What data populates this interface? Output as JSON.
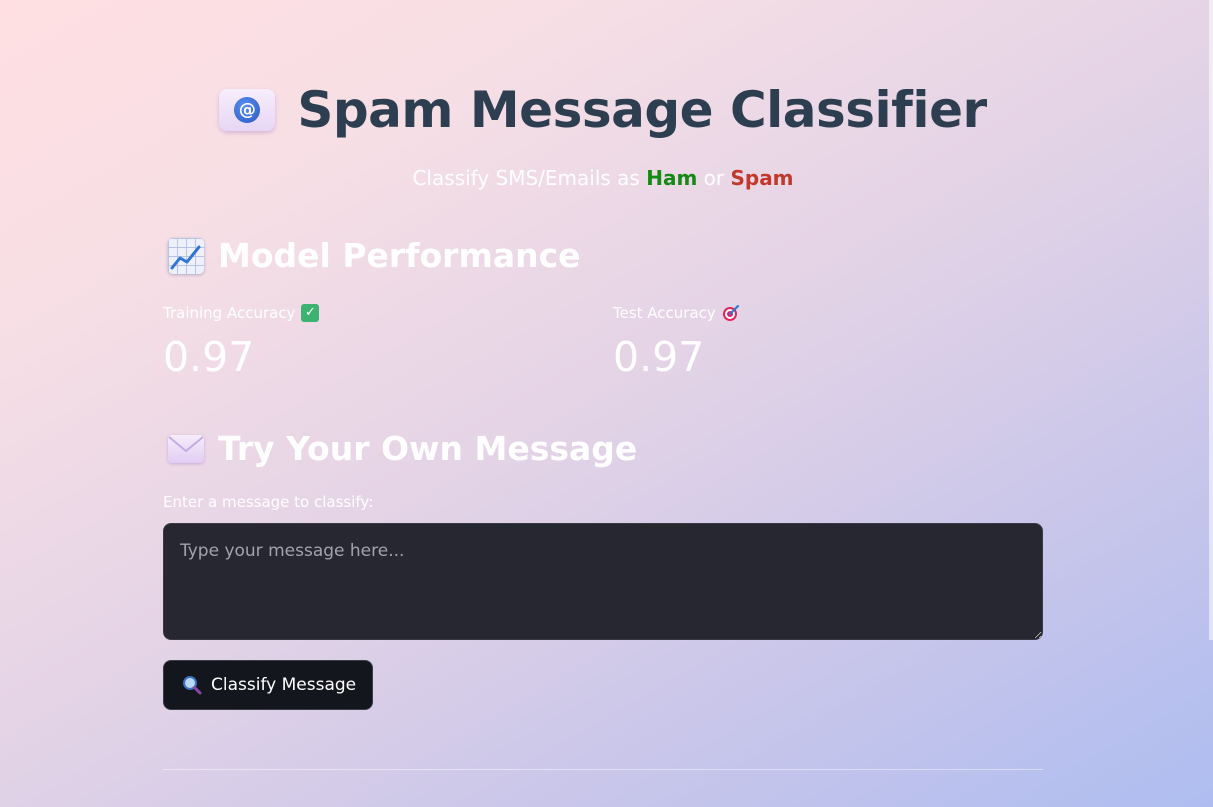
{
  "header": {
    "title": "Spam Message Classifier",
    "subtitle_prefix": "Classify SMS/Emails as ",
    "ham": "Ham",
    "or": " or ",
    "spam": "Spam"
  },
  "performance": {
    "heading": "Model Performance",
    "training_label": "Training Accuracy",
    "training_value": "0.97",
    "test_label": "Test Accuracy",
    "test_value": "0.97"
  },
  "try_section": {
    "heading": "Try Your Own Message",
    "input_label": "Enter a message to classify:",
    "input_placeholder": "Type your message here...",
    "input_value": "",
    "button_label": "Classify Message"
  },
  "icons": {
    "title": "envelope-at-icon",
    "performance": "chart-increasing-icon",
    "try": "envelope-icon",
    "training": "check-mark-icon",
    "test": "target-icon",
    "button": "magnifier-icon"
  },
  "colors": {
    "ham": "#138a13",
    "spam": "#c0392b",
    "title": "#2d3e50",
    "input_bg": "#272731",
    "button_bg": "#13161c"
  }
}
